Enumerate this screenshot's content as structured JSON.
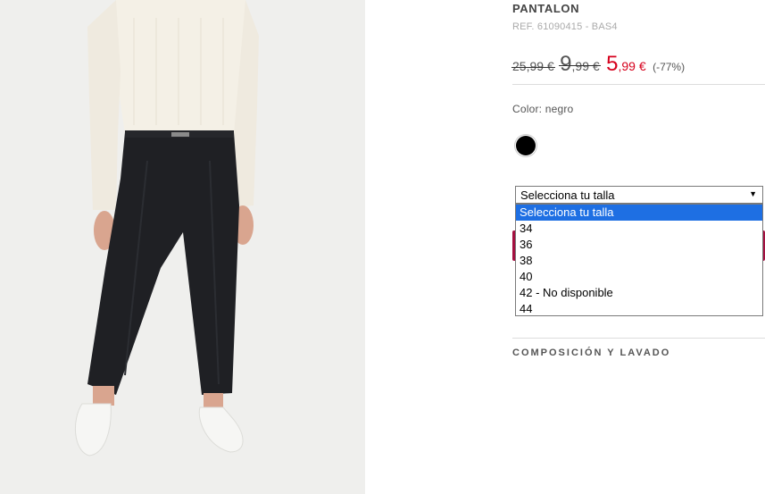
{
  "product": {
    "title": "PANTALON",
    "reference": "REF. 61090415 - BAS4",
    "image_alt": "model-wearing-black-trousers-white-sweater-white-shoes"
  },
  "prices": {
    "original": "25,99 €",
    "previous_main": "9",
    "previous_decimals": ",99 €",
    "sale_main": "5",
    "sale_decimals": ",99 €",
    "discount": "(-77%)",
    "sale_color": "#d6001c"
  },
  "color": {
    "label": "Color: negro",
    "swatch_hex": "#000000"
  },
  "size_select": {
    "selected_value": "Selecciona tu talla",
    "arrow": "▼",
    "options": [
      "Selecciona tu talla",
      "34",
      "36",
      "38",
      "40",
      "42 - No disponible",
      "44"
    ],
    "highlight_color": "#1e6fe3"
  },
  "sections": {
    "composition": "COMPOSICIÓN Y LAVADO"
  },
  "accent_button_color": "#a31040"
}
